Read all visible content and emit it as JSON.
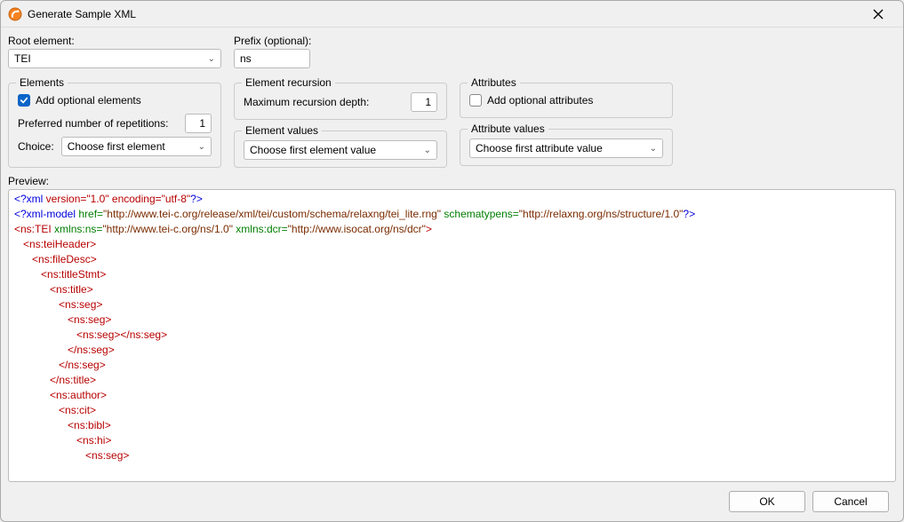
{
  "window": {
    "title": "Generate Sample XML"
  },
  "root": {
    "label": "Root element:",
    "value": "TEI"
  },
  "prefix": {
    "label": "Prefix (optional):",
    "value": "ns"
  },
  "elements": {
    "legend": "Elements",
    "add_optional_label": "Add optional elements",
    "add_optional_checked": true,
    "repetitions_label": "Preferred number of repetitions:",
    "repetitions_value": "1",
    "choice_label": "Choice:",
    "choice_value": "Choose first element"
  },
  "recursion": {
    "legend": "Element recursion",
    "depth_label": "Maximum recursion depth:",
    "depth_value": "1"
  },
  "element_values": {
    "legend": "Element values",
    "value": "Choose first element value"
  },
  "attributes": {
    "legend": "Attributes",
    "add_optional_label": "Add optional attributes",
    "add_optional_checked": false
  },
  "attribute_values": {
    "legend": "Attribute values",
    "value": "Choose first attribute value"
  },
  "preview": {
    "label": "Preview:"
  },
  "xml": {
    "decl": {
      "open": "<?xml",
      "attrs": " version=\"1.0\" encoding=\"utf-8\"",
      "close": "?>"
    },
    "model": {
      "open": "<?xml-model ",
      "href_key": "href=",
      "href_val": "\"http://www.tei-c.org/release/xml/tei/custom/schema/relaxng/tei_lite.rng\"",
      "st_key": " schematypens=",
      "st_val": "\"http://relaxng.org/ns/structure/1.0\"",
      "close": "?>"
    },
    "rootEl": {
      "open": "<ns:TEI ",
      "ns1_key": "xmlns:ns=",
      "ns1_val": "\"http://www.tei-c.org/ns/1.0\"",
      "ns2_key": " xmlns:dcr=",
      "ns2_val": "\"http://www.isocat.org/ns/dcr\"",
      "close": ">"
    },
    "l4": "<ns:teiHeader>",
    "l5": "<ns:fileDesc>",
    "l6": "<ns:titleStmt>",
    "l7": "<ns:title>",
    "l8": "<ns:seg>",
    "l9": "<ns:seg>",
    "l10a": "<ns:seg>",
    "l10b": "</ns:seg>",
    "l11": "</ns:seg>",
    "l12": "</ns:seg>",
    "l13": "</ns:title>",
    "l14": "<ns:author>",
    "l15": "<ns:cit>",
    "l16": "<ns:bibl>",
    "l17": "<ns:hi>",
    "l18": "<ns:seg>"
  },
  "footer": {
    "ok": "OK",
    "cancel": "Cancel"
  }
}
